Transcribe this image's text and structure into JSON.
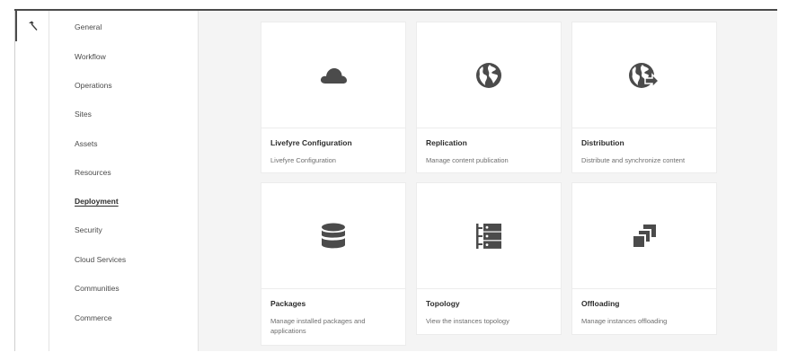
{
  "toolbar": {
    "tool_icon": "hammer-icon"
  },
  "sidebar": {
    "items": [
      {
        "label": "General"
      },
      {
        "label": "Workflow"
      },
      {
        "label": "Operations"
      },
      {
        "label": "Sites"
      },
      {
        "label": "Assets"
      },
      {
        "label": "Resources"
      },
      {
        "label": "Deployment",
        "active": true
      },
      {
        "label": "Security"
      },
      {
        "label": "Cloud Services"
      },
      {
        "label": "Communities"
      },
      {
        "label": "Commerce"
      }
    ]
  },
  "cards": [
    {
      "title": "Livefyre Configuration",
      "description": "Livefyre Configuration",
      "icon": "cloud-icon"
    },
    {
      "title": "Replication",
      "description": "Manage content publication",
      "icon": "globe-icon"
    },
    {
      "title": "Distribution",
      "description": "Distribute and synchronize content",
      "icon": "globe-arrow-icon"
    },
    {
      "title": "Packages",
      "description": "Manage installed packages and applications",
      "icon": "database-icon"
    },
    {
      "title": "Topology",
      "description": "View the instances topology",
      "icon": "topology-icon"
    },
    {
      "title": "Offloading",
      "description": "Manage instances offloading",
      "icon": "offloading-icon"
    }
  ],
  "colors": {
    "icon": "#4b4b4b",
    "background": "#f4f4f4",
    "card": "#ffffff"
  }
}
